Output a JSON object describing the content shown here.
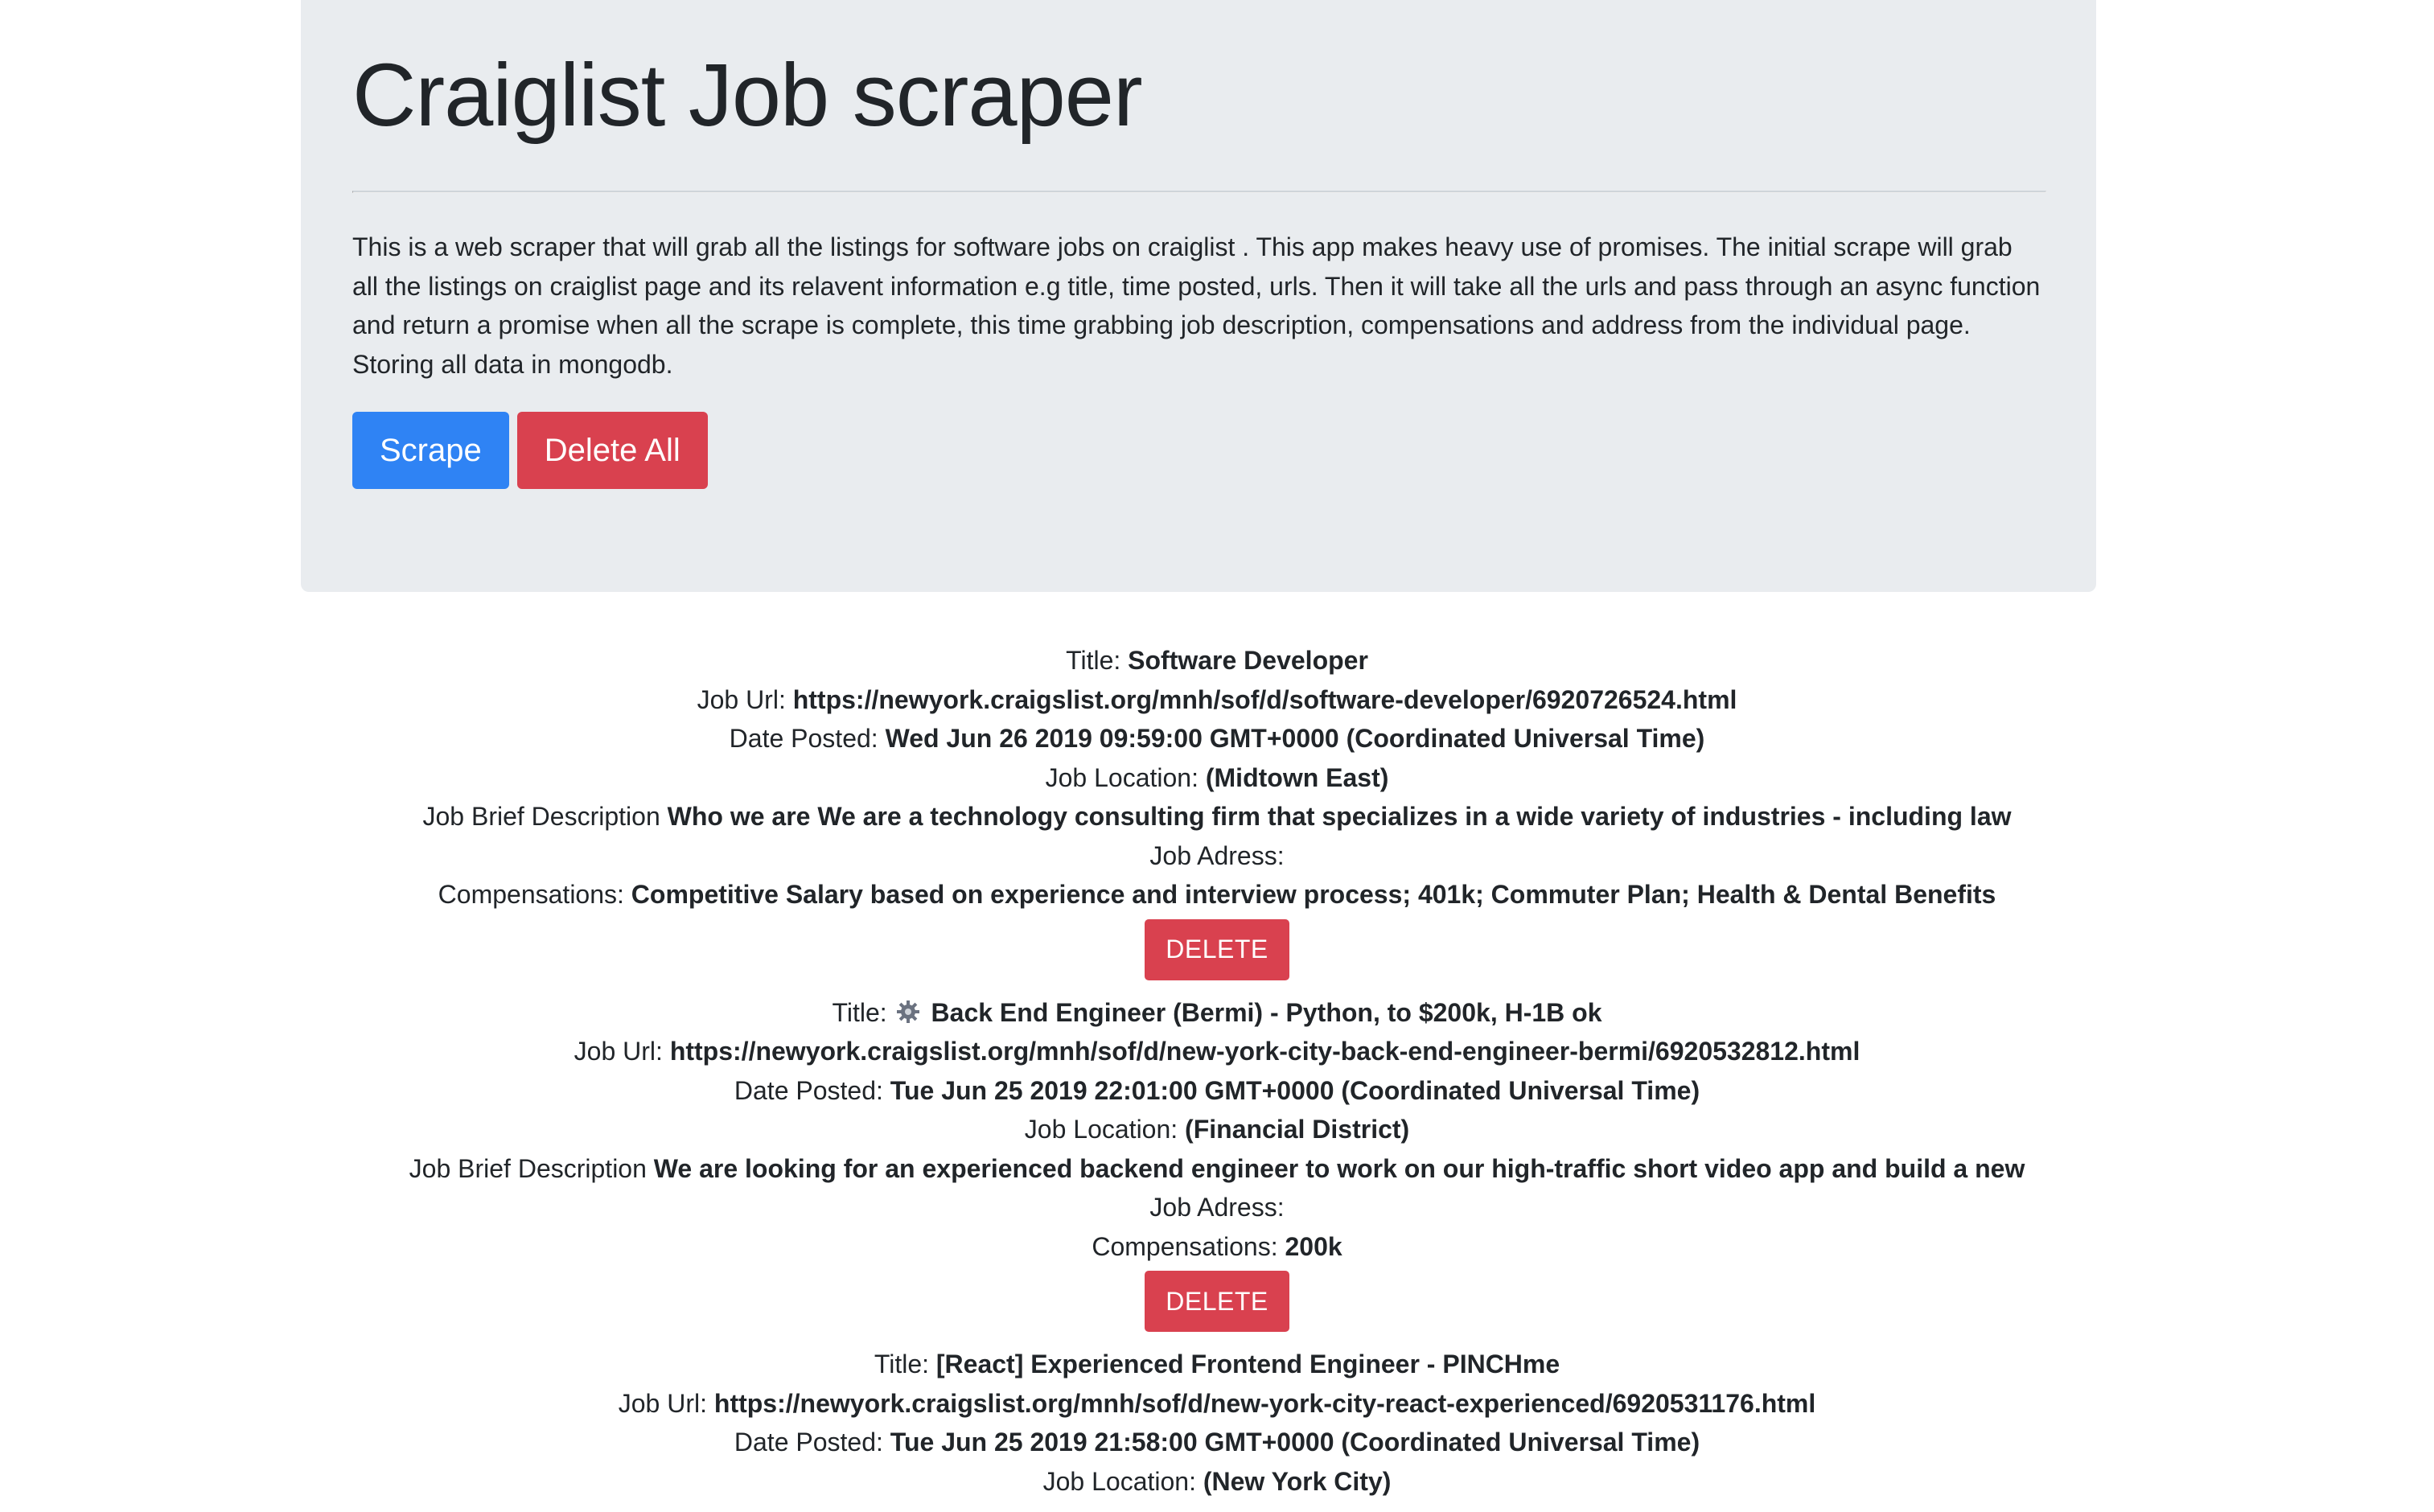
{
  "header": {
    "title": "Craiglist Job scraper",
    "description": "This is a web scraper that will grab all the listings for software jobs on craiglist . This app makes heavy use of promises. The initial scrape will grab all the listings on craiglist page and its relavent information e.g title, time posted, urls. Then it will take all the urls and pass through an async function and return a promise when all the scrape is complete, this time grabbing job description, compensations and address from the individual page. Storing all data in mongodb.",
    "scrape_label": "Scrape",
    "delete_all_label": "Delete All"
  },
  "labels": {
    "title": "Title: ",
    "url": "Job Url: ",
    "date": "Date Posted: ",
    "location": "Job Location: ",
    "description": "Job Brief Description ",
    "address": "Job Adress: ",
    "compensation": "Compensations: ",
    "delete": "DELETE"
  },
  "jobs": [
    {
      "title": "Software Developer",
      "url": "https://newyork.craigslist.org/mnh/sof/d/software-developer/6920726524.html",
      "date": "Wed Jun 26 2019 09:59:00 GMT+0000 (Coordinated Universal Time)",
      "location": "(Midtown East)",
      "description": "Who we are We are a technology consulting firm that specializes in a wide variety of industries - including law",
      "address": "",
      "compensation": "Competitive Salary based on experience and interview process; 401k; Commuter Plan; Health & Dental Benefits"
    },
    {
      "title_icon": "gear-icon",
      "title": "Back End Engineer (Bermi) - Python, to $200k, H-1B ok",
      "url": "https://newyork.craigslist.org/mnh/sof/d/new-york-city-back-end-engineer-bermi/6920532812.html",
      "date": "Tue Jun 25 2019 22:01:00 GMT+0000 (Coordinated Universal Time)",
      "location": "(Financial District)",
      "description": "We are looking for an experienced backend engineer to work on our high-traffic short video app and build a new",
      "address": "",
      "compensation": "200k"
    },
    {
      "title": "[React] Experienced Frontend Engineer - PINCHme",
      "url": "https://newyork.craigslist.org/mnh/sof/d/new-york-city-react-experienced/6920531176.html",
      "date": "Tue Jun 25 2019 21:58:00 GMT+0000 (Coordinated Universal Time)",
      "location": "(New York City)"
    }
  ],
  "colors": {
    "jumbotron_bg": "#e9ecef",
    "primary": "#2f83f4",
    "danger": "#d9414f"
  }
}
